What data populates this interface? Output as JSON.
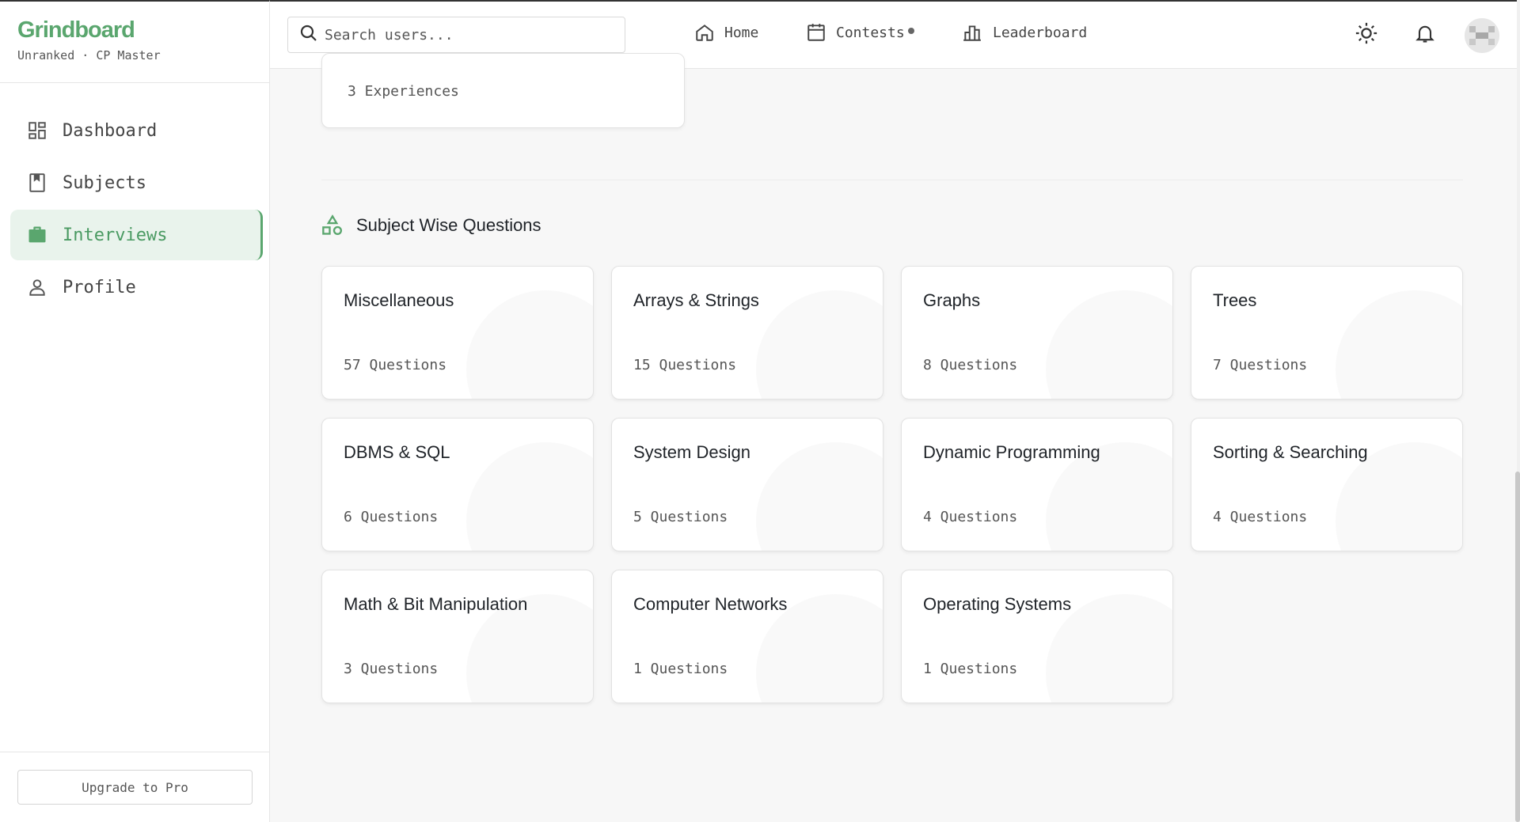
{
  "brand": {
    "title": "Grindboard",
    "subtitle": "Unranked · CP Master"
  },
  "sidebar": {
    "items": [
      {
        "label": "Dashboard",
        "icon": "dashboard-icon",
        "active": false
      },
      {
        "label": "Subjects",
        "icon": "bookmark-icon",
        "active": false
      },
      {
        "label": "Interviews",
        "icon": "briefcase-icon",
        "active": true
      },
      {
        "label": "Profile",
        "icon": "user-icon",
        "active": false
      }
    ],
    "upgrade_label": "Upgrade to Pro"
  },
  "search": {
    "placeholder": "Search users..."
  },
  "topnav": {
    "home": "Home",
    "contests": "Contests",
    "leaderboard": "Leaderboard"
  },
  "experience_card": {
    "count_text": "3 Experiences"
  },
  "section": {
    "title": "Subject Wise Questions"
  },
  "subjects": [
    {
      "name": "Miscellaneous",
      "count": "57 Questions"
    },
    {
      "name": "Arrays & Strings",
      "count": "15 Questions"
    },
    {
      "name": "Graphs",
      "count": "8 Questions"
    },
    {
      "name": "Trees",
      "count": "7 Questions"
    },
    {
      "name": "DBMS & SQL",
      "count": "6 Questions"
    },
    {
      "name": "System Design",
      "count": "5 Questions"
    },
    {
      "name": "Dynamic Programming",
      "count": "4 Questions"
    },
    {
      "name": "Sorting & Searching",
      "count": "4 Questions"
    },
    {
      "name": "Math & Bit Manipulation",
      "count": "3 Questions"
    },
    {
      "name": "Computer Networks",
      "count": "1 Questions"
    },
    {
      "name": "Operating Systems",
      "count": "1 Questions"
    }
  ],
  "colors": {
    "accent": "#5aa66e",
    "active_bg": "#e9f3ec"
  }
}
